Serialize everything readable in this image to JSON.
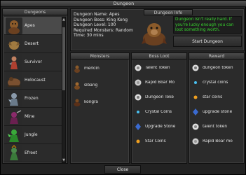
{
  "window": {
    "title": "Dungeon"
  },
  "dungeons": {
    "header": "Dungeons",
    "items": [
      {
        "label": "Apes",
        "icon": "ape-icon",
        "color": "#8a5a2a"
      },
      {
        "label": "Desert",
        "icon": "desert-creature-icon",
        "color": "#a07a40"
      },
      {
        "label": "Survivor",
        "icon": "survivor-icon",
        "color": "#b04030"
      },
      {
        "label": "Holocaust",
        "icon": "holocaust-creature-icon",
        "color": "#7a5030"
      },
      {
        "label": "Frozen",
        "icon": "frozen-creature-icon",
        "color": "#6a7a8a"
      },
      {
        "label": "Mine",
        "icon": "mine-creature-icon",
        "color": "#8a2a6a"
      },
      {
        "label": "Jungle",
        "icon": "jungle-creature-icon",
        "color": "#2a8a2a"
      },
      {
        "label": "Efreet",
        "icon": "efreet-icon",
        "color": "#3a7a3a"
      }
    ]
  },
  "info": {
    "header": "Dungeon Info",
    "name_line": "Dungeon Name: Apes",
    "boss_line": "Dungeon Boss: King Kong",
    "level_line": "Dungeon Level: 100",
    "monsters_line": "Required Monsters: Random",
    "time_line": "Time: 30 mins",
    "warning": "Dungeon isn't really hard. If you're lucky enough you can loot something worth.",
    "start_label": "Start Dungeon"
  },
  "monsters": {
    "header": "Monsters",
    "items": [
      {
        "label": "merklin",
        "icon": "merklin-icon"
      },
      {
        "label": "sibang",
        "icon": "sibang-icon"
      },
      {
        "label": "kongra",
        "icon": "kongra-icon"
      }
    ]
  },
  "boss_loot": {
    "header": "Boss Loot",
    "items": [
      {
        "label": "Talent Token",
        "icon": "talent-token-icon"
      },
      {
        "label": "Rapid Boar Mo",
        "icon": "rapid-boar-mount-icon"
      },
      {
        "label": "Dungeon Toke",
        "icon": "dungeon-token-icon"
      },
      {
        "label": "Crystal Coins",
        "icon": "crystal-coin-icon"
      },
      {
        "label": "Upgrade Stone",
        "icon": "upgrade-stone-icon"
      },
      {
        "label": "Star Coins",
        "icon": "star-coin-icon"
      }
    ]
  },
  "reward": {
    "header": "Reward",
    "items": [
      {
        "label": "dungeon token",
        "icon": "dungeon-token-icon"
      },
      {
        "label": "crystal coins",
        "icon": "crystal-coin-icon"
      },
      {
        "label": "star coins",
        "icon": "star-coin-icon"
      },
      {
        "label": "upgrade stone",
        "icon": "upgrade-stone-icon"
      },
      {
        "label": "talent token",
        "icon": "talent-token-icon"
      },
      {
        "label": "Rapid Boar mo",
        "icon": "rapid-boar-mount-icon"
      }
    ]
  },
  "footer": {
    "close_label": "Close"
  }
}
